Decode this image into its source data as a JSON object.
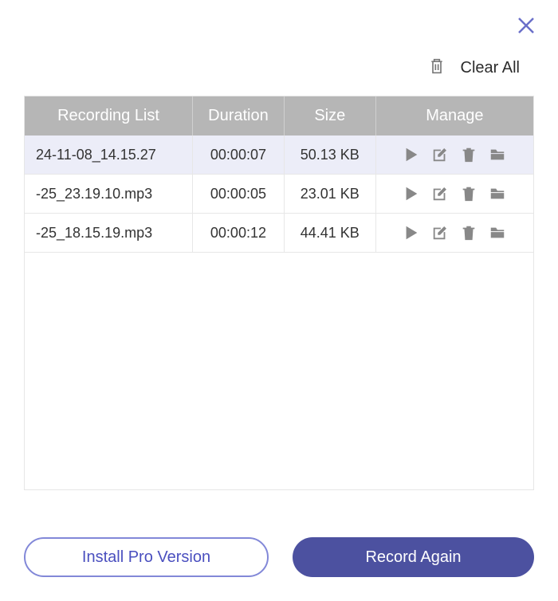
{
  "header": {
    "clear_label": "Clear All"
  },
  "table": {
    "columns": {
      "name": "Recording List",
      "duration": "Duration",
      "size": "Size",
      "manage": "Manage"
    },
    "rows": [
      {
        "name": "24-11-08_14.15.27",
        "duration": "00:00:07",
        "size": "50.13 KB",
        "selected": true
      },
      {
        "name": "-25_23.19.10.mp3",
        "duration": "00:00:05",
        "size": "23.01 KB",
        "selected": false
      },
      {
        "name": "-25_18.15.19.mp3",
        "duration": "00:00:12",
        "size": "44.41 KB",
        "selected": false
      }
    ]
  },
  "footer": {
    "install_label": "Install Pro Version",
    "record_label": "Record Again"
  },
  "colors": {
    "accent": "#4c51a0",
    "outline": "#8288d8",
    "header_bg": "#b6b6b6"
  }
}
